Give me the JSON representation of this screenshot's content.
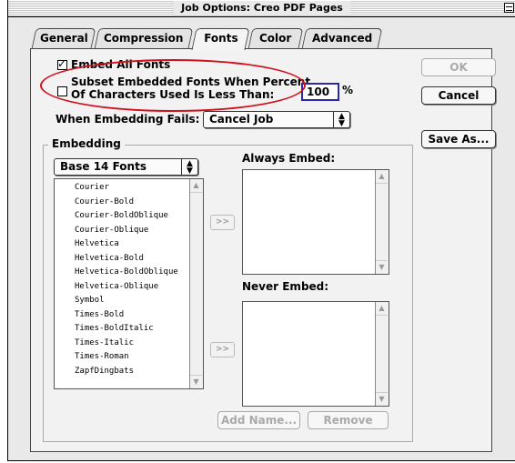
{
  "window": {
    "title": "Job Options: Creo PDF Pages"
  },
  "tabs": [
    {
      "label": "General"
    },
    {
      "label": "Compression"
    },
    {
      "label": "Fonts"
    },
    {
      "label": "Color"
    },
    {
      "label": "Advanced"
    }
  ],
  "fonts": {
    "embed_all_label": "Embed All Fonts",
    "embed_all_checked": true,
    "subset_label_line1": "Subset Embedded Fonts When Percent",
    "subset_label_line2": "Of Characters Used Is Less Than:",
    "subset_checked": false,
    "subset_percent": "100",
    "percent_sign": "%",
    "when_fails_label": "When Embedding Fails:",
    "when_fails_value": "Cancel Job"
  },
  "embedding": {
    "group_label": "Embedding",
    "font_set": "Base 14 Fonts",
    "font_list": [
      "Courier",
      "Courier-Bold",
      "Courier-BoldOblique",
      "Courier-Oblique",
      "Helvetica",
      "Helvetica-Bold",
      "Helvetica-BoldOblique",
      "Helvetica-Oblique",
      "Symbol",
      "Times-Bold",
      "Times-BoldItalic",
      "Times-Italic",
      "Times-Roman",
      "ZapfDingbats"
    ],
    "always_embed_label": "Always Embed:",
    "never_embed_label": "Never Embed:",
    "move_button_label": ">>",
    "add_name_label": "Add Name...",
    "remove_label": "Remove"
  },
  "buttons": {
    "ok": "OK",
    "cancel": "Cancel",
    "save_as": "Save As..."
  },
  "colors": {
    "highlight_ellipse": "#d0101c",
    "input_focus": "#2a2aa8"
  },
  "icons": [
    "collapse-icon",
    "popup-arrows-icon",
    "scroll-up-arrow-icon",
    "scroll-down-arrow-icon"
  ]
}
